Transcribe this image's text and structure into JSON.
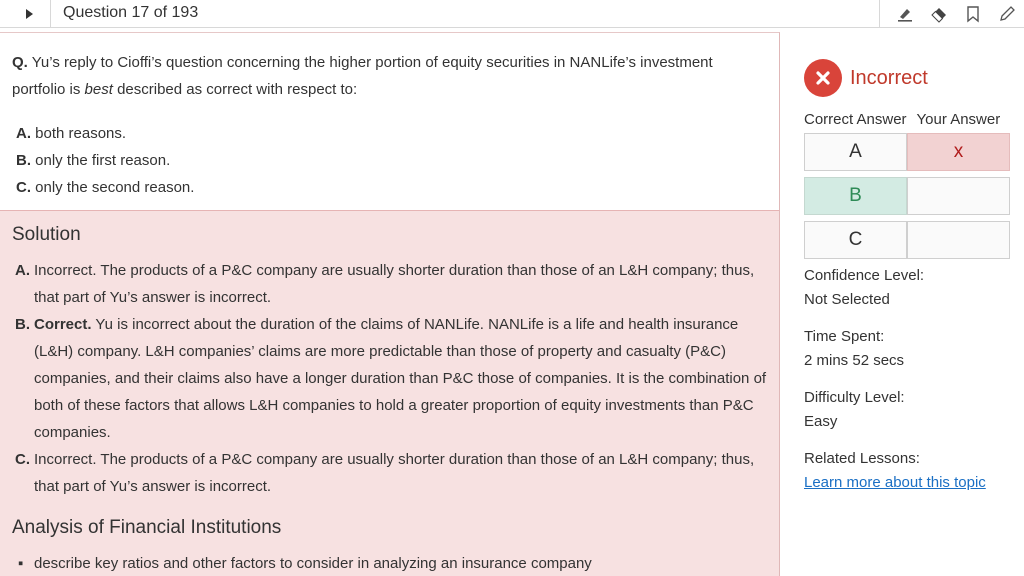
{
  "header": {
    "question_counter": "Question 17 of 193"
  },
  "question": {
    "prefix": "Q.",
    "text_before": " Yu’s reply to Cioffi’s question concerning the higher portion of equity securities in NANLife’s investment portfolio is ",
    "emphasis": "best",
    "text_after": " described as correct with respect to:"
  },
  "options": [
    {
      "letter": "A.",
      "text": " both reasons."
    },
    {
      "letter": "B.",
      "text": " only the first reason."
    },
    {
      "letter": "C.",
      "text": " only the second reason."
    }
  ],
  "solution": {
    "title": "Solution",
    "items": [
      {
        "letter": "A.",
        "lead": "",
        "text": "Incorrect. The products of a P&C company are usually shorter duration than those of an L&H company; thus, that part of Yu’s answer is incorrect."
      },
      {
        "letter": "B.",
        "lead": "Correct.",
        "text": " Yu is incorrect about the duration of the claims of NANLife. NANLife is a life and health insurance (L&H) company. L&H companies’ claims are more predictable than those of property and casualty (P&C) companies, and their claims also have a longer duration than P&C those of companies. It is the combination of both of these factors that allows L&H companies to hold a greater proportion of equity investments than P&C companies."
      },
      {
        "letter": "C.",
        "lead": "",
        "text": "Incorrect. The products of a P&C company are usually shorter duration than those of an L&H company; thus, that part of Yu’s answer is incorrect."
      }
    ]
  },
  "lesson": {
    "title": "Analysis of Financial Institutions",
    "bullets": [
      "describe key ratios and other factors to consider in analyzing an insurance company"
    ]
  },
  "result": {
    "status": "Incorrect",
    "correct_answer_header": "Correct Answer",
    "your_answer_header": "Your Answer",
    "rows": [
      {
        "option": "A",
        "your_mark": "x"
      },
      {
        "option": "B",
        "your_mark": ""
      },
      {
        "option": "C",
        "your_mark": ""
      }
    ],
    "correct_option": "B",
    "selected_option": "A"
  },
  "meta": {
    "confidence_label": "Confidence Level:",
    "confidence_value": "Not Selected",
    "time_label": "Time Spent:",
    "time_value": "2 mins 52 secs",
    "difficulty_label": "Difficulty Level:",
    "difficulty_value": "Easy",
    "related_label": "Related Lessons:",
    "related_link": "Learn more about this topic"
  },
  "colors": {
    "incorrect_red": "#d9443a",
    "correct_green_bg": "#d3ebe3",
    "selected_red_bg": "#f2d2d2",
    "solution_bg": "#f7e1e1",
    "link_blue": "#1a6fc4"
  },
  "icons": [
    "play-icon",
    "highlighter-icon",
    "eraser-icon",
    "bookmark-icon",
    "pencil-icon",
    "close-icon"
  ]
}
